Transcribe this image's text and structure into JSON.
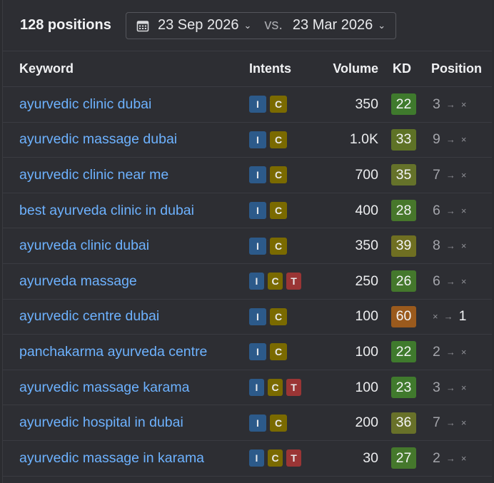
{
  "header": {
    "positions_label": "128 positions",
    "date_from": "23 Sep 2026",
    "vs_label": "vs.",
    "date_to": "23 Mar 2026"
  },
  "columns": {
    "keyword": "Keyword",
    "intents": "Intents",
    "volume": "Volume",
    "kd": "KD",
    "position": "Position"
  },
  "intent_colors": {
    "I": "#2c5a8a",
    "C": "#7a6a00",
    "T": "#9a3535"
  },
  "rows": [
    {
      "keyword": "ayurvedic clinic dubai",
      "intents": [
        "I",
        "C"
      ],
      "volume": "350",
      "kd": "22",
      "kd_color": "#3f7a2d",
      "pos_from": "3",
      "pos_to": "×",
      "to_bright": false
    },
    {
      "keyword": "ayurvedic massage dubai",
      "intents": [
        "I",
        "C"
      ],
      "volume": "1.0K",
      "kd": "33",
      "kd_color": "#5e7226",
      "pos_from": "9",
      "pos_to": "×",
      "to_bright": false
    },
    {
      "keyword": "ayurvedic clinic near me",
      "intents": [
        "I",
        "C"
      ],
      "volume": "700",
      "kd": "35",
      "kd_color": "#65722a",
      "pos_from": "7",
      "pos_to": "×",
      "to_bright": false
    },
    {
      "keyword": "best ayurveda clinic in dubai",
      "intents": [
        "I",
        "C"
      ],
      "volume": "400",
      "kd": "28",
      "kd_color": "#47772b",
      "pos_from": "6",
      "pos_to": "×",
      "to_bright": false
    },
    {
      "keyword": "ayurveda clinic dubai",
      "intents": [
        "I",
        "C"
      ],
      "volume": "350",
      "kd": "39",
      "kd_color": "#6f6f22",
      "pos_from": "8",
      "pos_to": "×",
      "to_bright": false
    },
    {
      "keyword": "ayurveda massage",
      "intents": [
        "I",
        "C",
        "T"
      ],
      "volume": "250",
      "kd": "26",
      "kd_color": "#44782c",
      "pos_from": "6",
      "pos_to": "×",
      "to_bright": false
    },
    {
      "keyword": "ayurvedic centre dubai",
      "intents": [
        "I",
        "C"
      ],
      "volume": "100",
      "kd": "60",
      "kd_color": "#9a5a1d",
      "pos_from": "×",
      "pos_to": "1",
      "to_bright": true
    },
    {
      "keyword": "panchakarma ayurveda centre",
      "intents": [
        "I",
        "C"
      ],
      "volume": "100",
      "kd": "22",
      "kd_color": "#3f7a2d",
      "pos_from": "2",
      "pos_to": "×",
      "to_bright": false
    },
    {
      "keyword": "ayurvedic massage karama",
      "intents": [
        "I",
        "C",
        "T"
      ],
      "volume": "100",
      "kd": "23",
      "kd_color": "#407a2d",
      "pos_from": "3",
      "pos_to": "×",
      "to_bright": false
    },
    {
      "keyword": "ayurvedic hospital in dubai",
      "intents": [
        "I",
        "C"
      ],
      "volume": "200",
      "kd": "36",
      "kd_color": "#687129",
      "pos_from": "7",
      "pos_to": "×",
      "to_bright": false
    },
    {
      "keyword": "ayurvedic massage in karama",
      "intents": [
        "I",
        "C",
        "T"
      ],
      "volume": "30",
      "kd": "27",
      "kd_color": "#45782c",
      "pos_from": "2",
      "pos_to": "×",
      "to_bright": false
    }
  ]
}
